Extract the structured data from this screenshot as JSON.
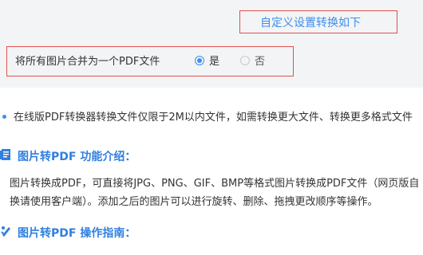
{
  "settings": {
    "custom_settings_label": "自定义设置转换如下",
    "merge_label": "将所有图片合并为一个PDF文件",
    "option_yes": "是",
    "option_no": "否",
    "selected": "是"
  },
  "notice": {
    "text": "在线版PDF转换器转换文件仅限于2M以内文件，如需转换更大文件、转换更多格式文件"
  },
  "intro": {
    "title": "图片转PDF 功能介绍：",
    "line1": "图片转换成PDF，可直接将JPG、PNG、GIF、BMP等格式图片转换成PDF文件（网页版自",
    "line2": "换请使用客户端）。添加之后的图片可以进行旋转、删除、拖拽更改顺序等操作。"
  },
  "guide": {
    "title": "图片转PDF 操作指南："
  },
  "colors": {
    "accent": "#3d8ef0",
    "highlight_border": "#e05050",
    "panel_bg": "#f3f4f5"
  },
  "icons": [
    "document-list-icon",
    "tool-pen-icon",
    "radio-selected-icon",
    "radio-unselected-icon",
    "bullet-dot-icon"
  ]
}
